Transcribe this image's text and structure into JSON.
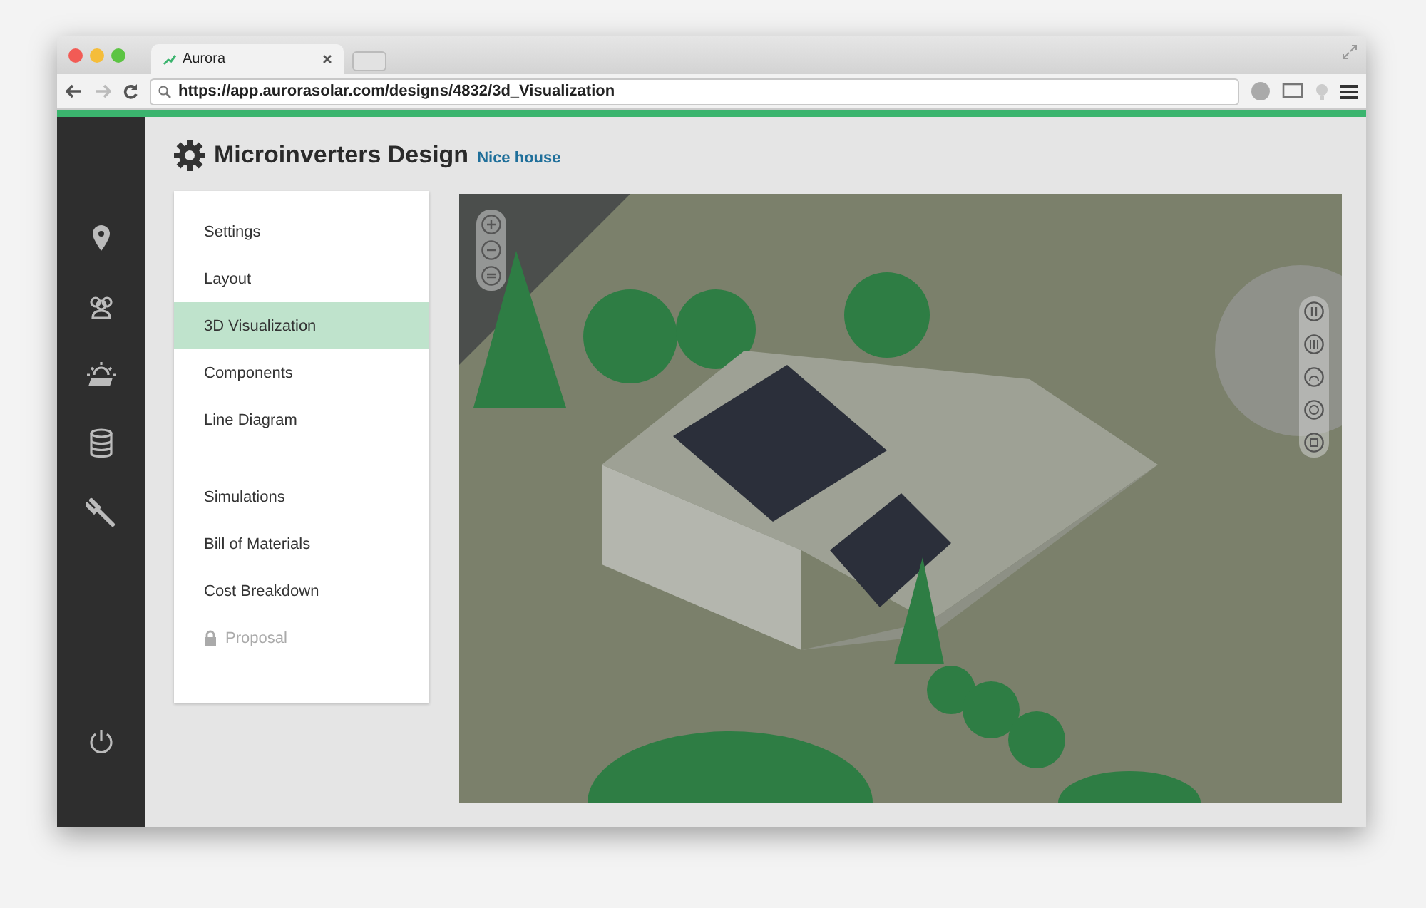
{
  "browser": {
    "tab_title": "Aurora",
    "url": "https://app.aurorasolar.com/designs/4832/3d_Visualization"
  },
  "header": {
    "title": "Microinverters Design",
    "subtitle": "Nice house"
  },
  "menu": {
    "groups": [
      [
        {
          "label": "Settings",
          "selected": false,
          "disabled": false
        },
        {
          "label": "Layout",
          "selected": false,
          "disabled": false
        },
        {
          "label": "3D Visualization",
          "selected": true,
          "disabled": false
        },
        {
          "label": "Components",
          "selected": false,
          "disabled": false
        },
        {
          "label": "Line Diagram",
          "selected": false,
          "disabled": false
        }
      ],
      [
        {
          "label": "Simulations",
          "selected": false,
          "disabled": false
        },
        {
          "label": "Bill of Materials",
          "selected": false,
          "disabled": false
        },
        {
          "label": "Cost Breakdown",
          "selected": false,
          "disabled": false
        },
        {
          "label": "Proposal",
          "selected": false,
          "disabled": true
        }
      ]
    ]
  }
}
